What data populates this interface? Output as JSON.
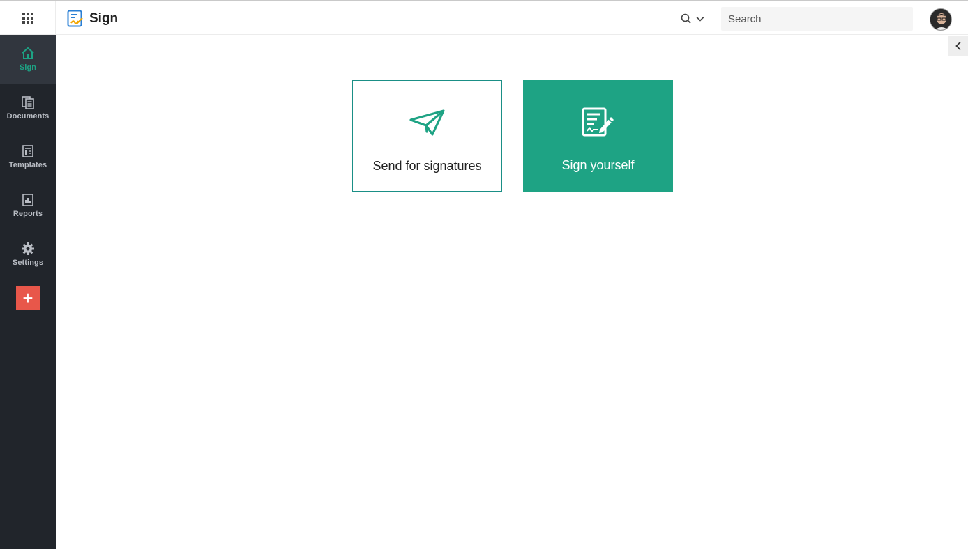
{
  "app": {
    "title": "Sign",
    "brand_color": "#1ea384"
  },
  "topbar": {
    "apps_icon": "apps-grid-icon",
    "search_scope_icon": "search-icon",
    "search": {
      "placeholder": "Search",
      "value": ""
    },
    "avatar_icon": "user-avatar"
  },
  "sidebar": {
    "background": "#21252b",
    "items": [
      {
        "label": "Sign",
        "icon": "home-icon",
        "active": true
      },
      {
        "label": "Documents",
        "icon": "documents-icon",
        "active": false
      },
      {
        "label": "Templates",
        "icon": "templates-icon",
        "active": false
      },
      {
        "label": "Reports",
        "icon": "reports-icon",
        "active": false
      },
      {
        "label": "Settings",
        "icon": "gear-icon",
        "active": false
      }
    ],
    "add_button": {
      "label": "+",
      "color": "#e8574a"
    }
  },
  "main": {
    "cards": [
      {
        "label": "Send for signatures",
        "icon": "paper-plane-icon",
        "style": "outlined"
      },
      {
        "label": "Sign yourself",
        "icon": "sign-document-icon",
        "style": "filled"
      }
    ]
  }
}
